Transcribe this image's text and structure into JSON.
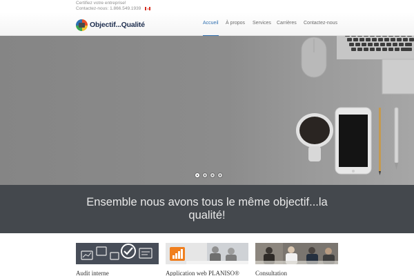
{
  "topbar": {
    "tagline": "Certifiez votre entreprise!",
    "contact": "Contactez-nous: 1.866.549.1939"
  },
  "header": {
    "logo_text": "Objectif...Qualité",
    "nav": [
      {
        "label": "Accueil",
        "active": true
      },
      {
        "label": "À propos",
        "active": false
      },
      {
        "label": "Services",
        "active": false
      },
      {
        "label": "Carrières",
        "active": false
      },
      {
        "label": "Contactez-nous",
        "active": false
      }
    ]
  },
  "hero": {
    "slides_count": 4,
    "active_slide": 1
  },
  "banner": {
    "text": "Ensemble nous avons tous le même objectif...la qualité!"
  },
  "cards": [
    {
      "title": "Audit interne"
    },
    {
      "title": "Application web PLANISO®"
    },
    {
      "title": "Consultation"
    }
  ],
  "colors": {
    "accent": "#2f6fb0",
    "banner_bg": "#44484d",
    "hero_bg": "#8a8a8a"
  }
}
